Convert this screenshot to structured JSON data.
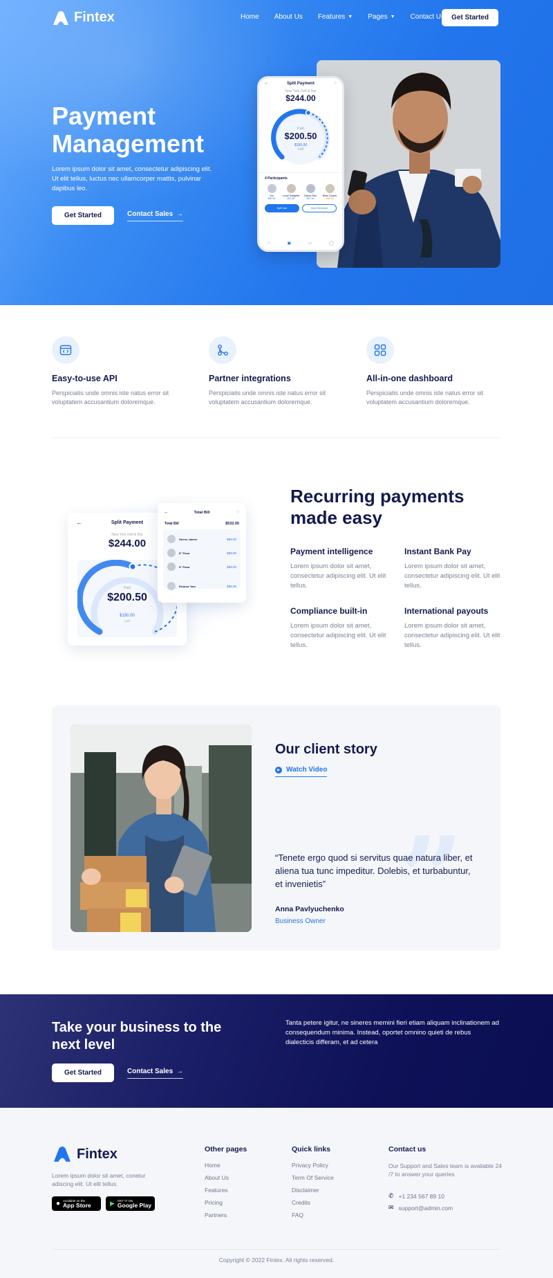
{
  "brand": {
    "name": "Fintex"
  },
  "nav": {
    "links": [
      {
        "label": "Home",
        "dropdown": false
      },
      {
        "label": "About Us",
        "dropdown": false
      },
      {
        "label": "Features",
        "dropdown": true
      },
      {
        "label": "Pages",
        "dropdown": true
      },
      {
        "label": "Contact Us",
        "dropdown": false
      }
    ],
    "cta": "Get Started"
  },
  "hero": {
    "title": "Payment Management",
    "description": "Lorem ipsum dolor sit amet, consectetur adipiscing elit. Ut elit tellus, luctus nec ullamcorper mattis, pulvinar dapibus leo.",
    "cta": "Get Started",
    "link": "Contact Sales",
    "phone": {
      "title": "Split Payment",
      "subtitle": "New York Grill & Bar",
      "total": "$244.00",
      "paid_label": "Paid",
      "paid": "$200.50",
      "left": "$150.00",
      "left_label": "Left",
      "participants_label": "4 Participants",
      "participants": [
        {
          "name": "You",
          "amount": "$50.00"
        },
        {
          "name": "Lunch Bridgette",
          "amount": "$47.80"
        },
        {
          "name": "Danny Paul",
          "amount": "$47.30"
        },
        {
          "name": "Brian Cooper",
          "amount": "$48.40"
        }
      ],
      "btn_primary": "Split Link",
      "btn_secondary": "Send Reminder"
    }
  },
  "features": [
    {
      "icon": "api-window-icon",
      "title": "Easy-to-use API",
      "description": "Perspiciatis unde omnis iste natus error sit voluptatem accusantium doloremque."
    },
    {
      "icon": "integration-nodes-icon",
      "title": "Partner integrations",
      "description": "Perspiciatis unde omnis iste natus error sit voluptatem accusantium doloremque."
    },
    {
      "icon": "dashboard-grid-icon",
      "title": "All-in-one dashboard",
      "description": "Perspiciatis unde omnis iste natus error sit voluptatem accusantium doloremque."
    }
  ],
  "recurring": {
    "title": "Recurring payments made easy",
    "items": [
      {
        "title": "Payment intelligence",
        "description": "Lorem ipsum dolor sit amet, consectetur adipiscing elit. Ut elit tellus."
      },
      {
        "title": "Instant Bank Pay",
        "description": "Lorem ipsum dolor sit amet, consectetur adipiscing elit. Ut elit tellus."
      },
      {
        "title": "Compliance built-in",
        "description": "Lorem ipsum dolor sit amet, consectetur adipiscing elit. Ut elit tellus."
      },
      {
        "title": "International payouts",
        "description": "Lorem ipsum dolor sit amet, consectetur adipiscing elit. Ut elit tellus."
      }
    ],
    "card_split": {
      "title": "Split Payment",
      "subtitle": "New York Grill & Bar",
      "total": "$244.00",
      "paid_label": "Paid",
      "paid": "$200.50",
      "left": "$150.00",
      "left_label": "Left"
    },
    "card_bill": {
      "title": "Total Bill",
      "label": "Total Bill",
      "total": "$532.00",
      "rows": [
        {
          "name": "Stereo Jabeer",
          "amount": "$68.00"
        },
        {
          "name": "8\" Pizza",
          "amount": "$68.00"
        },
        {
          "name": "8\" Pizza",
          "amount": "$58.00"
        },
        {
          "name": "Eleanor Yam",
          "amount": "$98.00"
        }
      ]
    }
  },
  "story": {
    "title": "Our client story",
    "link": "Watch Video",
    "quote": "“Tenete ergo quod si servitus quae natura liber, et aliena tua tunc impeditur. Dolebis, et turbabuntur, et invenietis”",
    "author": "Anna Pavlyuchenko",
    "role": "Business Owner"
  },
  "cta": {
    "title": "Take your business to the next level",
    "button": "Get Started",
    "link": "Contact Sales",
    "text": "Tanta petere igitur, ne sineres memini fieri etiam aliquam inclinationem ad consequendum minima. Instead, oportet omnino quieti de rebus dialecticis differam, et ad cetera"
  },
  "footer": {
    "about": "Lorem ipsum dolor sit amet, conetur adiscing elit. Ut elit tellus.",
    "app_store": {
      "small": "Available on the",
      "big": "App Store"
    },
    "google_play": {
      "small": "GET IT ON",
      "big": "Google Play"
    },
    "other_pages": {
      "heading": "Other pages",
      "links": [
        "Home",
        "About Us",
        "Features",
        "Pricing",
        "Partners"
      ]
    },
    "quick_links": {
      "heading": "Quick links",
      "links": [
        "Privacy Policy",
        "Term Of Service",
        "Disclaimer",
        "Credits",
        "FAQ"
      ]
    },
    "contact": {
      "heading": "Contact us",
      "description": "Our Support and Sales team is available 24 /7 to answer your queries",
      "phone": "+1 234 567 89 10",
      "email": "support@admin.com"
    },
    "copyright": "Copyright © 2022 Fintex. All rights reserved."
  },
  "colors": {
    "primary": "#2275ec",
    "navy": "#141a4d",
    "cta_bg": "#0e1157",
    "muted": "#7a8196",
    "light_bg": "#f4f6fa"
  }
}
